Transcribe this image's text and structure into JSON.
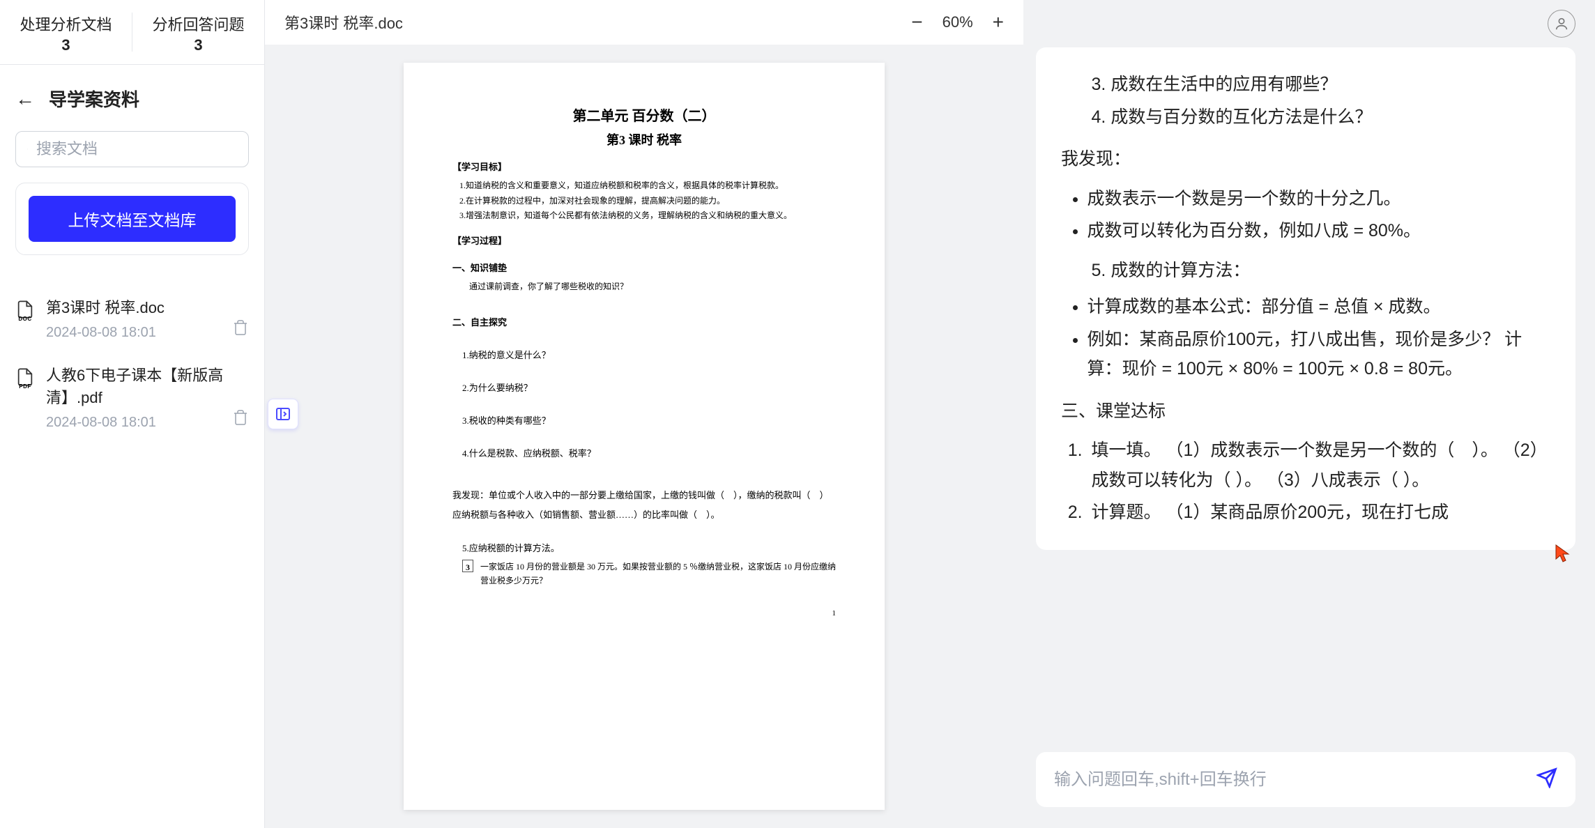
{
  "sidebar": {
    "tabs": [
      {
        "label": "处理分析文档",
        "count": "3"
      },
      {
        "label": "分析回答问题",
        "count": "3"
      }
    ],
    "title": "导学案资料",
    "search_placeholder": "搜索文档",
    "upload_label": "上传文档至文档库",
    "docs": [
      {
        "name": "第3课时 税率.doc",
        "date": "2024-08-08 18:01",
        "type": "DOC"
      },
      {
        "name": "人教6下电子课本【新版高清】.pdf",
        "date": "2024-08-08 18:01",
        "type": "PDF"
      }
    ]
  },
  "viewer": {
    "title": "第3课时 税率.doc",
    "zoom": "60%",
    "page": {
      "unit": "第二单元 百分数（二）",
      "lesson": "第3 课时 税率",
      "obj_header": "【学习目标】",
      "obj1": "1.知道纳税的含义和重要意义，知道应纳税额和税率的含义，根据具体的税率计算税款。",
      "obj2": "2.在计算税款的过程中，加深对社会现象的理解，提高解决问题的能力。",
      "obj3": "3.增强法制意识，知道每个公民都有依法纳税的义务，理解纳税的含义和纳税的重大意义。",
      "proc_header": "【学习过程】",
      "s1": "一、知识铺垫",
      "s1_text": "通过课前调查，你了解了哪些税收的知识？",
      "s2": "二、自主探究",
      "q1": "1.纳税的意义是什么？",
      "q2": "2.为什么要纳税？",
      "q3": "3.税收的种类有哪些？",
      "q4": "4.什么是税款、应纳税额、税率？",
      "discover": "我发现：单位或个人收入中的一部分要上缴给国家，上缴的钱叫做（　），缴纳的税款叫（　）应纳税额与各种收入（如销售额、营业额……）的比率叫做（　）。",
      "calc": "5.应纳税额的计算方法。",
      "problem_num": "3",
      "problem_text": "一家饭店 10 月份的营业额是 30 万元。如果按营业额的 5 ％缴纳营业税，这家饭店 10 月份应缴纳营业税多少万元？",
      "page_num": "1"
    }
  },
  "chat": {
    "q3": "成数在生活中的应用有哪些？",
    "q4": "成数与百分数的互化方法是什么？",
    "discover_label": "我发现：",
    "d1": "成数表示一个数是另一个数的十分之几。",
    "d2": "成数可以转化为百分数，例如八成 = 80%。",
    "m5": "成数的计算方法：",
    "f1": "计算成数的基本公式：部分值 = 总值 × 成数。",
    "f2": "例如：某商品原价100元，打八成出售，现价是多少？ 计算：现价 = 100元 × 80% = 100元 × 0.8 = 80元。",
    "section3": "三、课堂达标",
    "t1": "填一填。 （1）成数表示一个数是另一个数的（　）。 （2）成数可以转化为（ ）。 （3）八成表示（ ）。",
    "t2": "计算题。 （1）某商品原价200元，现在打七成",
    "input_placeholder": "输入问题回车,shift+回车换行"
  }
}
